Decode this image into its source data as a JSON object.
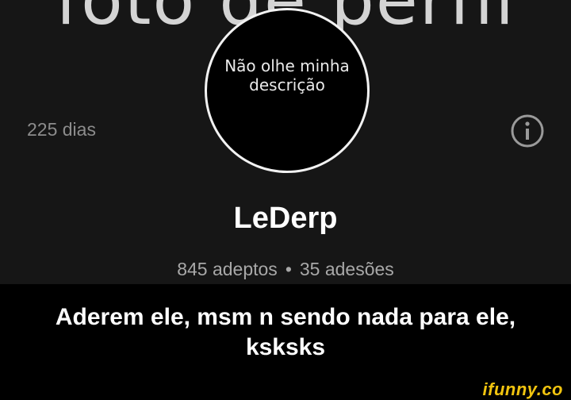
{
  "profile": {
    "background_title": "foto de perfil",
    "days_label": "225 dias",
    "info_icon": "info-circle-icon",
    "avatar_text_line1": "Não olhe minha",
    "avatar_text_line2": "descrição",
    "username": "LeDerp",
    "followers": "845 adeptos",
    "separator": "•",
    "joins": "35 adesões"
  },
  "caption": {
    "line1": "Aderem ele, msm n sendo nada para ele,",
    "line2": "ksksks"
  },
  "watermark": {
    "text": "ifunny.co"
  },
  "colors": {
    "panel_background": "#161616",
    "page_background": "#000000",
    "watermark": "#f1c40f"
  }
}
